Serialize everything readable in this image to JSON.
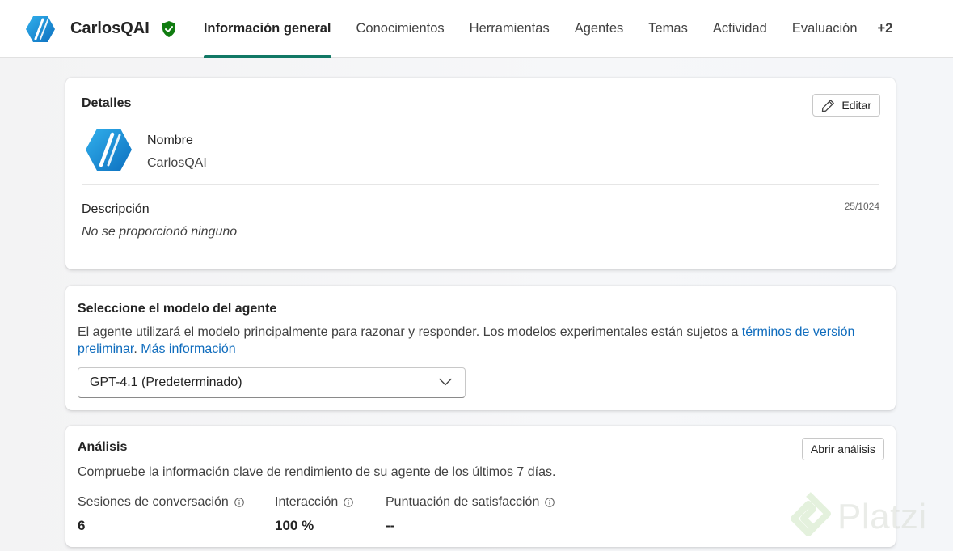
{
  "app": {
    "name": "CarlosQAI"
  },
  "tabs": [
    {
      "label": "Información general"
    },
    {
      "label": "Conocimientos"
    },
    {
      "label": "Herramientas"
    },
    {
      "label": "Agentes"
    },
    {
      "label": "Temas"
    },
    {
      "label": "Actividad"
    },
    {
      "label": "Evaluación"
    },
    {
      "label": "+2"
    }
  ],
  "details": {
    "title": "Detalles",
    "edit_label": "Editar",
    "name_label": "Nombre",
    "name_value": "CarlosQAI",
    "description_label": "Descripción",
    "description_value": "No se proporcionó ninguno",
    "char_counter": "25/1024"
  },
  "model": {
    "title": "Seleccione el modelo del agente",
    "description": "El agente utilizará el modelo principalmente para razonar y responder. Los modelos experimentales están sujetos a ",
    "terms_link": "términos de versión preliminar",
    "after_terms": ". ",
    "more_link": "Más información",
    "selected": "GPT-4.1 (Predeterminado)"
  },
  "analysis": {
    "title": "Análisis",
    "open_label": "Abrir análisis",
    "description": "Compruebe la información clave de rendimiento de su agente de los últimos 7 días.",
    "metrics": [
      {
        "label": "Sesiones de conversación",
        "value": "6"
      },
      {
        "label": "Interacción",
        "value": "100 %"
      },
      {
        "label": "Puntuación de satisfacción",
        "value": "--"
      }
    ]
  },
  "watermark": {
    "text": "Platzi"
  },
  "colors": {
    "accent": "#117865",
    "link": "#0f6cbd",
    "logo_blue": "#1a8fd6",
    "verified_green": "#107c10"
  }
}
